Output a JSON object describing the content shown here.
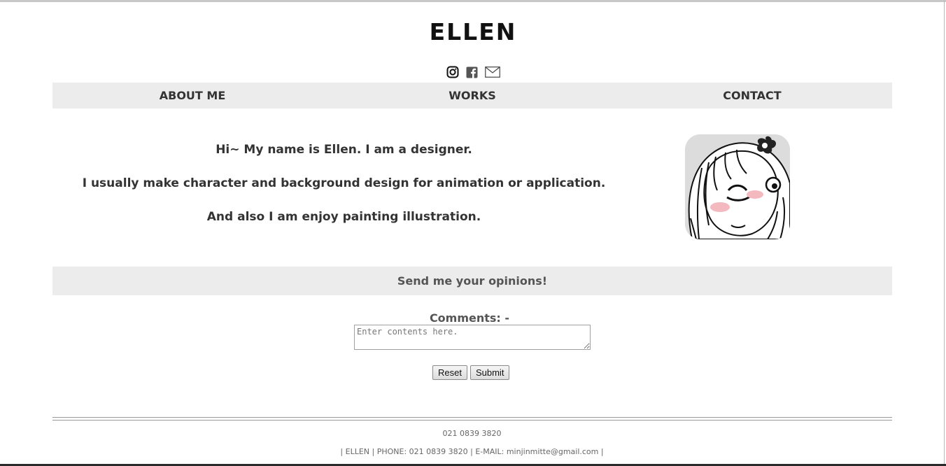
{
  "header": {
    "title": "ELLEN",
    "social": [
      "instagram-icon",
      "facebook-icon",
      "mail-icon"
    ]
  },
  "nav": {
    "items": [
      {
        "label": "ABOUT ME"
      },
      {
        "label": "WORKS"
      },
      {
        "label": "CONTACT"
      }
    ]
  },
  "intro": {
    "lines": [
      "Hi~ My name is Ellen. I am a designer.",
      "I usually make character and background design for animation or application.",
      "And also I am enjoy painting illustration."
    ]
  },
  "feedback": {
    "heading": "Send me your opinions!",
    "comments_label": "Comments: -",
    "placeholder": "Enter contents here.",
    "reset_label": "Reset",
    "submit_label": "Submit"
  },
  "footer": {
    "phone": "021 0839 3820",
    "info": "| ELLEN | PHONE: 021 0839 3820 | E-MAIL: minjinmitte@gmail.com |"
  },
  "colors": {
    "nav_background": "#ececec",
    "text": "#333333"
  }
}
